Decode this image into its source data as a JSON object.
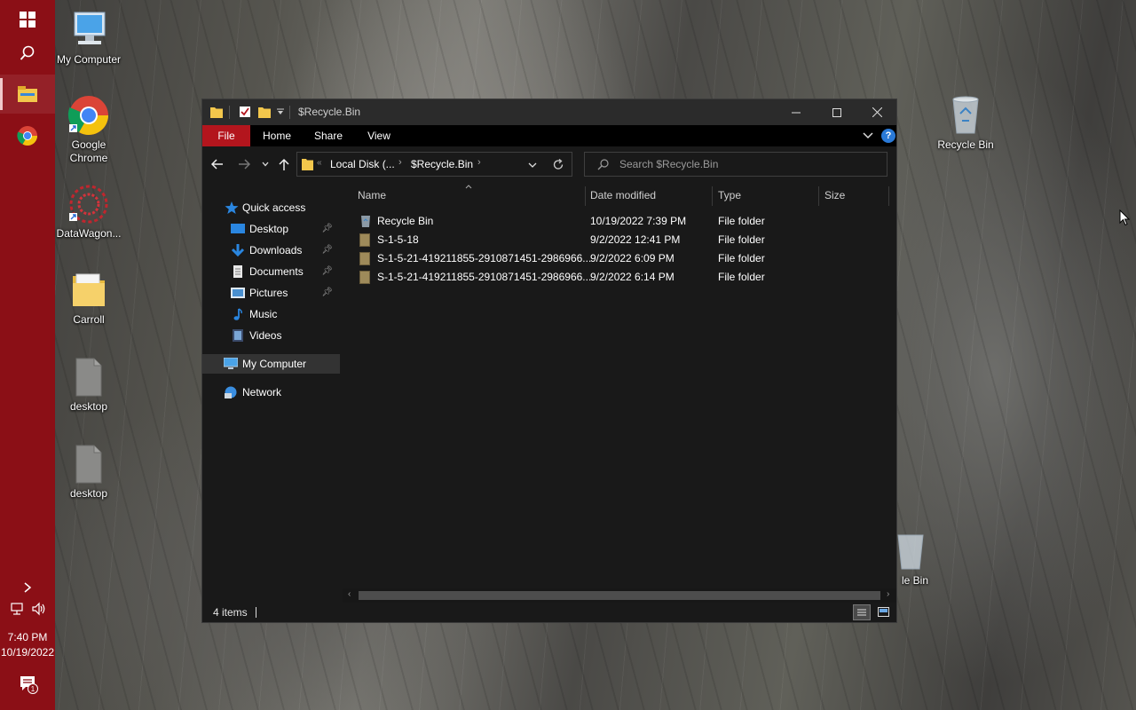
{
  "taskbar": {
    "icons": [
      "windows-start-icon",
      "search-icon",
      "file-explorer-icon",
      "chrome-icon"
    ],
    "time": "7:40 PM",
    "date": "10/19/2022",
    "notification_count": "1"
  },
  "desktop_icons": [
    {
      "label": "My Computer",
      "icon": "computer-icon"
    },
    {
      "label": "Google Chrome",
      "icon": "chrome-icon"
    },
    {
      "label": "DataWagon...",
      "icon": "datawagon-icon"
    },
    {
      "label": "Carroll",
      "icon": "folder-icon"
    },
    {
      "label": "desktop",
      "icon": "file-icon"
    },
    {
      "label": "desktop",
      "icon": "file-icon"
    },
    {
      "label": "Recycle Bin",
      "icon": "recycle-bin-icon"
    },
    {
      "label": "le Bin",
      "icon": "recycle-bin-icon"
    }
  ],
  "window": {
    "title": "$Recycle.Bin",
    "ribbon_tabs": [
      "File",
      "Home",
      "Share",
      "View"
    ],
    "breadcrumb": [
      "Local Disk (...",
      "$Recycle.Bin"
    ],
    "search_placeholder": "Search $Recycle.Bin",
    "nav": {
      "quick_access": "Quick access",
      "items": [
        {
          "label": "Desktop",
          "pinned": true
        },
        {
          "label": "Downloads",
          "pinned": true
        },
        {
          "label": "Documents",
          "pinned": true
        },
        {
          "label": "Pictures",
          "pinned": true
        },
        {
          "label": "Music",
          "pinned": false
        },
        {
          "label": "Videos",
          "pinned": false
        }
      ],
      "my_computer": "My Computer",
      "network": "Network"
    },
    "columns": [
      "Name",
      "Date modified",
      "Type",
      "Size"
    ],
    "rows": [
      {
        "name": "Recycle Bin",
        "date": "10/19/2022 7:39 PM",
        "type": "File folder",
        "size": ""
      },
      {
        "name": "S-1-5-18",
        "date": "9/2/2022 12:41 PM",
        "type": "File folder",
        "size": ""
      },
      {
        "name": "S-1-5-21-419211855-2910871451-2986966...",
        "date": "9/2/2022 6:09 PM",
        "type": "File folder",
        "size": ""
      },
      {
        "name": "S-1-5-21-419211855-2910871451-2986966...",
        "date": "9/2/2022 6:14 PM",
        "type": "File folder",
        "size": ""
      }
    ],
    "status": "4 items"
  }
}
